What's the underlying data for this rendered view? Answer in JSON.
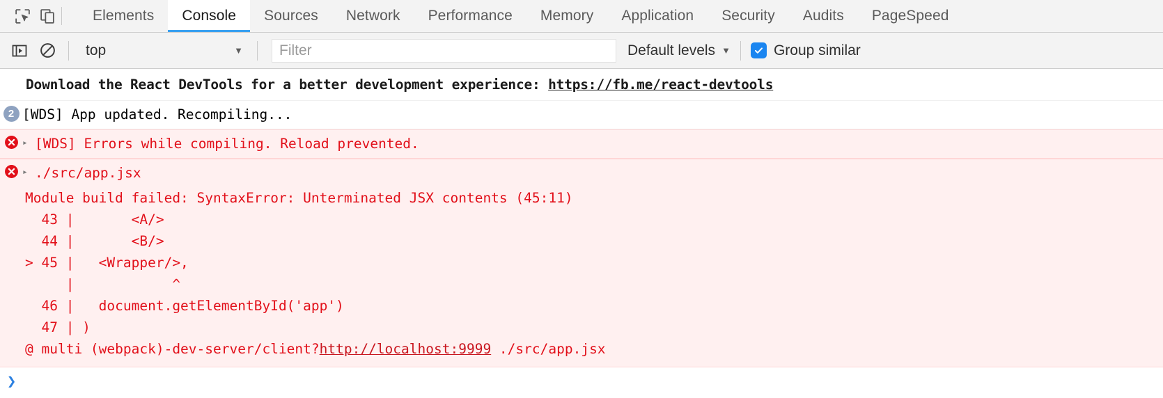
{
  "toolbar": {
    "inspect_icon": "inspect-element-icon",
    "device_icon": "device-toolbar-icon",
    "tabs": [
      {
        "label": "Elements",
        "active": false
      },
      {
        "label": "Console",
        "active": true
      },
      {
        "label": "Sources",
        "active": false
      },
      {
        "label": "Network",
        "active": false
      },
      {
        "label": "Performance",
        "active": false
      },
      {
        "label": "Memory",
        "active": false
      },
      {
        "label": "Application",
        "active": false
      },
      {
        "label": "Security",
        "active": false
      },
      {
        "label": "Audits",
        "active": false
      },
      {
        "label": "PageSpeed",
        "active": false
      }
    ]
  },
  "filterbar": {
    "sidebar_icon": "console-sidebar-icon",
    "clear_icon": "clear-console-icon",
    "context": "top",
    "context_caret": "▼",
    "filter_placeholder": "Filter",
    "filter_value": "",
    "levels_label": "Default levels",
    "levels_caret": "▼",
    "group_similar_label": "Group similar",
    "group_similar_checked": true,
    "accent_color": "#1a85f0"
  },
  "console": {
    "messages": [
      {
        "type": "info-bold",
        "text_before": "Download the React DevTools for a better development experience: ",
        "link_text": "https://fb.me/react-devtools"
      },
      {
        "type": "log-counted",
        "count": "2",
        "text": "[WDS] App updated. Recompiling..."
      },
      {
        "type": "error-collapsed",
        "arrow": "▸",
        "text": "[WDS] Errors while compiling. Reload prevented."
      },
      {
        "type": "error-expanded",
        "arrow": "▸",
        "title": "./src/app.jsx",
        "lines": [
          "Module build failed: SyntaxError: Unterminated JSX contents (45:11)",
          "",
          "  43 |       <A/>",
          "  44 |       <B/>",
          "> 45 |   <Wrapper/>,",
          "     |            ^",
          "  46 |   document.getElementById('app')",
          "  47 | )",
          ""
        ],
        "footer_before": "@ multi (webpack)-dev-server/client?",
        "footer_link": "http://localhost:9999",
        "footer_after": " ./src/app.jsx"
      }
    ],
    "prompt_chevron": "❯"
  }
}
